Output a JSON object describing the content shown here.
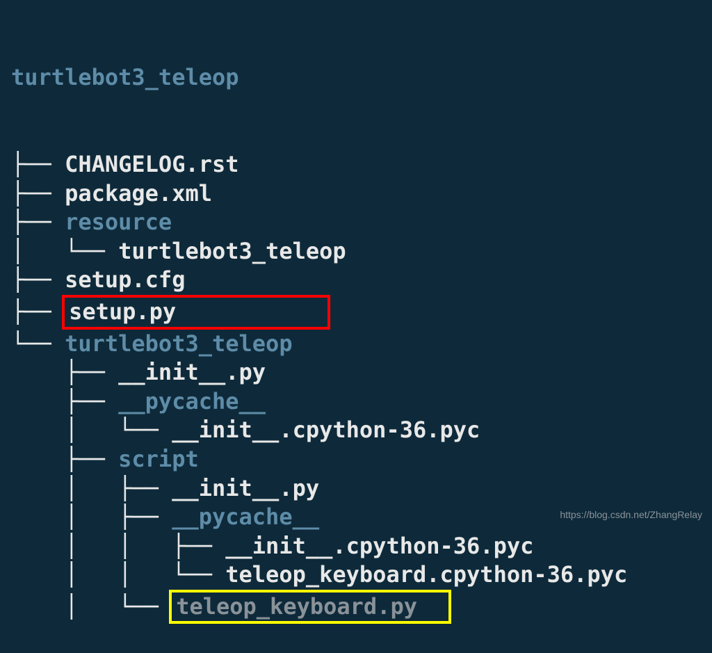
{
  "tree": {
    "root": "turtlebot3_teleop",
    "items": [
      {
        "prefix": "├── ",
        "name": "CHANGELOG.rst",
        "type": "file"
      },
      {
        "prefix": "├── ",
        "name": "package.xml",
        "type": "file"
      },
      {
        "prefix": "├── ",
        "name": "resource",
        "type": "dir"
      },
      {
        "prefix": "│   └── ",
        "name": "turtlebot3_teleop",
        "type": "file"
      },
      {
        "prefix": "├── ",
        "name": "setup.cfg",
        "type": "file"
      },
      {
        "prefix": "├── ",
        "name": "setup.py",
        "type": "file",
        "highlight": "red",
        "pad": "           "
      },
      {
        "prefix": "└── ",
        "name": "turtlebot3_teleop",
        "type": "dir"
      },
      {
        "prefix": "    ├── ",
        "name": "__init__.py",
        "type": "file"
      },
      {
        "prefix": "    ├── ",
        "name": "__pycache__",
        "type": "dir"
      },
      {
        "prefix": "    │   └── ",
        "name": "__init__.cpython-36.pyc",
        "type": "file"
      },
      {
        "prefix": "    ├── ",
        "name": "script",
        "type": "dir"
      },
      {
        "prefix": "    │   ├── ",
        "name": "__init__.py",
        "type": "file"
      },
      {
        "prefix": "    │   ├── ",
        "name": "__pycache__",
        "type": "dir"
      },
      {
        "prefix": "    │   │   ├── ",
        "name": "__init__.cpython-36.pyc",
        "type": "file"
      },
      {
        "prefix": "    │   │   └── ",
        "name": "teleop_keyboard.cpython-36.pyc",
        "type": "file"
      },
      {
        "prefix": "    │   └── ",
        "name": "teleop_keyboard.py",
        "type": "file",
        "highlight": "yellow",
        "pad": "  "
      }
    ]
  },
  "watermark": "https://blog.csdn.net/ZhangRelay"
}
